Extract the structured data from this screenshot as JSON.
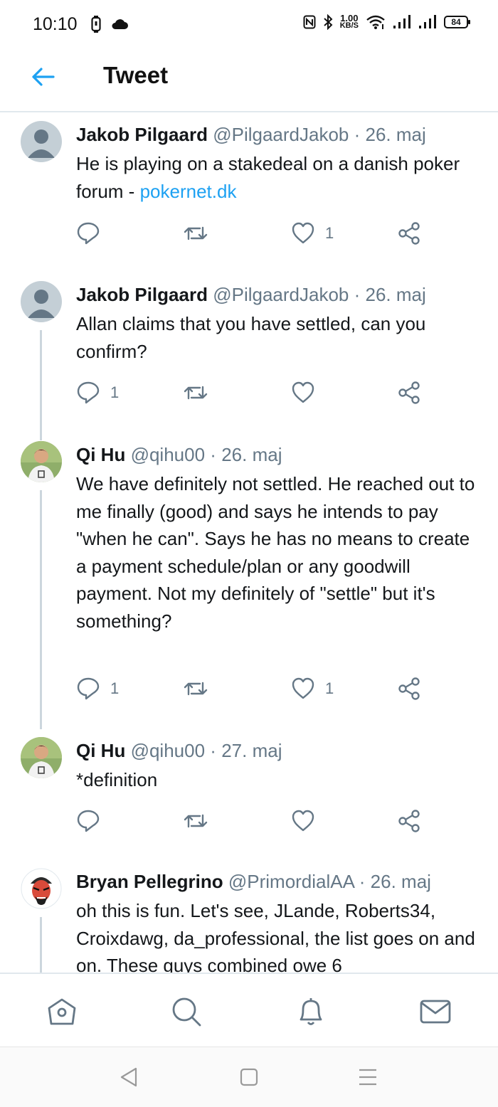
{
  "status_bar": {
    "time": "10:10",
    "left_icons": [
      "watch-icon",
      "cloud-icon"
    ],
    "right_icons": [
      "nfc-icon",
      "bluetooth-icon",
      "wifi-icon",
      "signal-icon",
      "signal-icon"
    ],
    "speed_value": "1.00",
    "speed_unit": "KB/S",
    "battery": "84"
  },
  "header": {
    "title": "Tweet",
    "back_icon": "arrow-left-icon",
    "accent": "#1da1f2"
  },
  "tweets": [
    {
      "name": "Jakob Pilgaard",
      "handle": "@PilgaardJakob",
      "dot": "·",
      "date": "26. maj",
      "text": "He is playing on a stakedeal on a danish poker forum - ",
      "link": "pokernet.dk",
      "reply_count": "",
      "retweet_count": "",
      "like_count": "1",
      "avatar": "default-avatar"
    },
    {
      "name": "Jakob Pilgaard",
      "handle": "@PilgaardJakob",
      "dot": "·",
      "date": "26. maj",
      "text": "Allan claims that you have settled, can you confirm?",
      "reply_count": "1",
      "retweet_count": "",
      "like_count": "",
      "avatar": "default-avatar"
    },
    {
      "name": "Qi Hu",
      "handle": "@qihu00",
      "dot": "·",
      "date": "26. maj",
      "text": "We have definitely not settled. He reached out to me finally (good) and says he intends to pay \"when he can\". Says he has no means to create a payment schedule/plan or any goodwill payment. Not my definitely of \"settle\" but it's something?",
      "reply_count": "1",
      "retweet_count": "",
      "like_count": "1",
      "avatar": "photo-avatar"
    },
    {
      "name": "Qi Hu",
      "handle": "@qihu00",
      "dot": "·",
      "date": "27. maj",
      "text": "*definition",
      "reply_count": "",
      "retweet_count": "",
      "like_count": "",
      "avatar": "photo-avatar"
    },
    {
      "name": "Bryan Pellegrino",
      "handle": "@PrimordialAA",
      "dot": "·",
      "date": "26. maj",
      "text": "oh this is fun. Let's see, JLande, Roberts34, Croixdawg, da_professional, the list goes on and on. These guys combined owe 6",
      "avatar": "cartoon-avatar"
    }
  ],
  "tabbar": {
    "items": [
      "home-icon",
      "search-icon",
      "notifications-icon",
      "messages-icon"
    ]
  },
  "navbar": {
    "items": [
      "nav-back-icon",
      "nav-home-icon",
      "nav-menu-icon"
    ]
  }
}
